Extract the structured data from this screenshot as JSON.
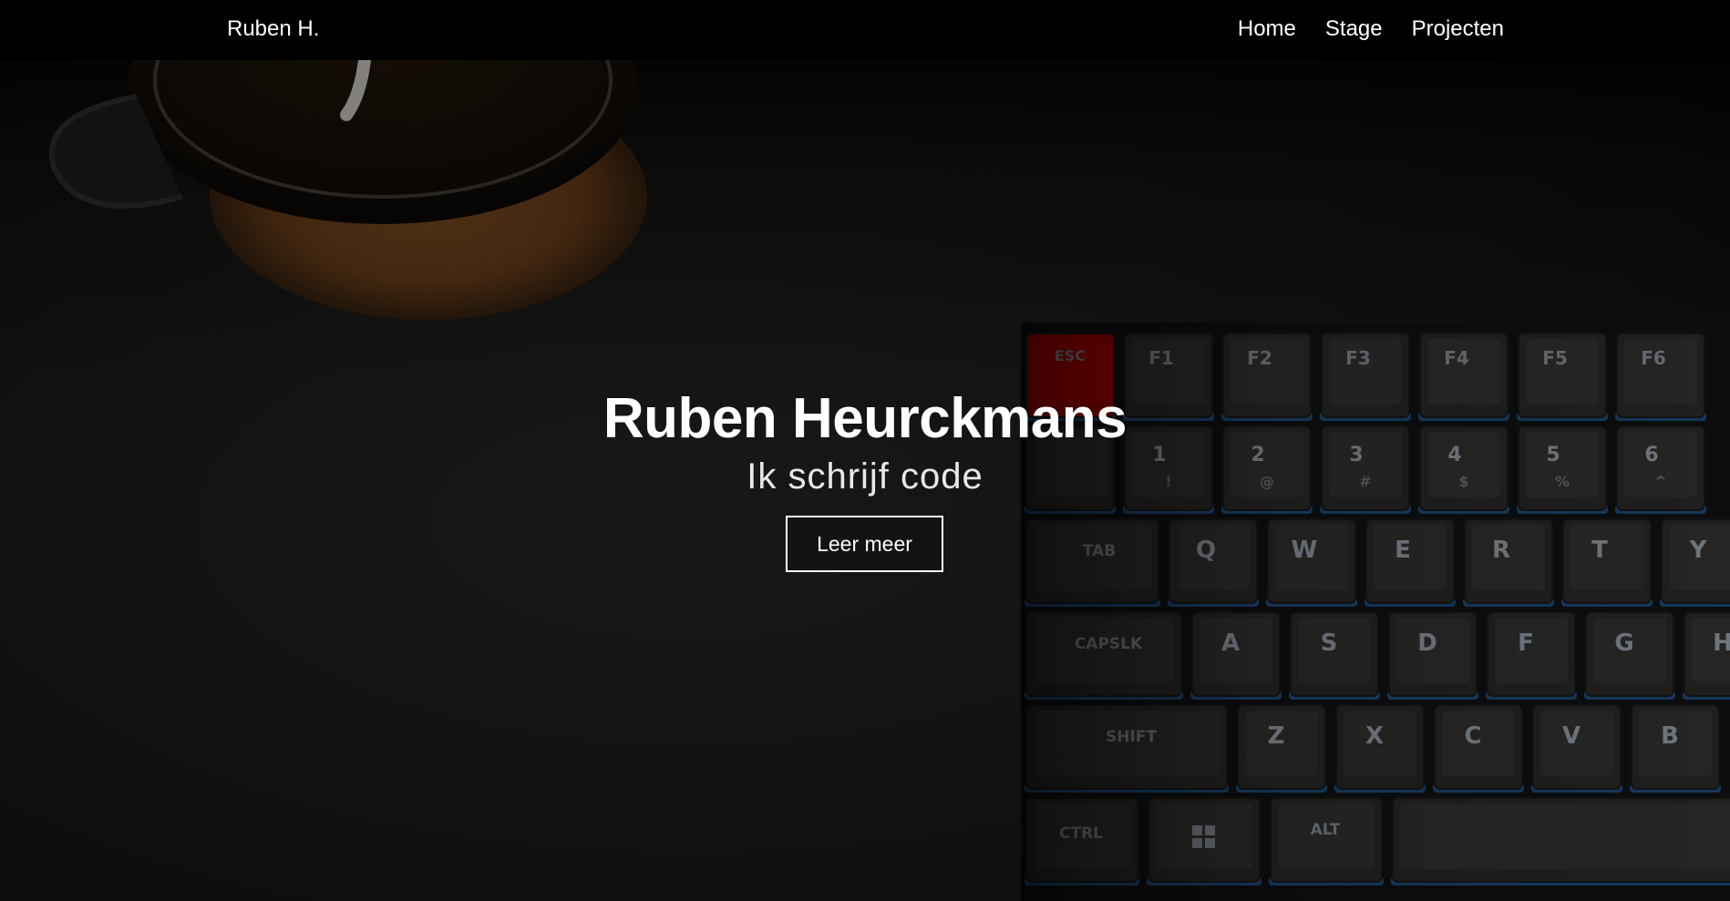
{
  "navbar": {
    "brand": "Ruben H.",
    "links": [
      {
        "label": "Home"
      },
      {
        "label": "Stage"
      },
      {
        "label": "Projecten"
      }
    ]
  },
  "hero": {
    "title": "Ruben Heurckmans",
    "subtitle": "Ik schrijf code",
    "button_label": "Leer meer"
  },
  "background": {
    "keyboard_keys": {
      "row0": [
        "ESC",
        "F1",
        "F2",
        "F3",
        "F4",
        "F5",
        "F6"
      ],
      "row1": [
        "1",
        "2",
        "3",
        "4",
        "5",
        "6"
      ],
      "row1_shift": [
        "!",
        "@",
        "#",
        "$",
        "%",
        "^"
      ],
      "row2": [
        "TAB",
        "Q",
        "W",
        "E",
        "R",
        "T",
        "Y"
      ],
      "row3": [
        "CAPSLK",
        "A",
        "S",
        "D",
        "F",
        "G",
        "H"
      ],
      "row4": [
        "SHIFT",
        "Z",
        "X",
        "C",
        "V",
        "B"
      ],
      "row5": [
        "CTRL",
        "ALT"
      ]
    },
    "colors": {
      "esc_key": "#b00000",
      "backlight": "#2e7fd9"
    }
  }
}
